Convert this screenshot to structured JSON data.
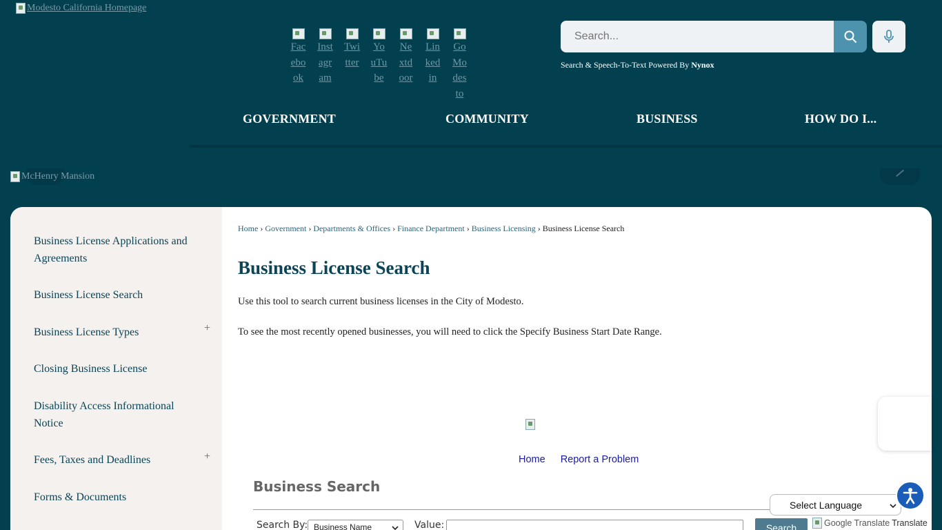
{
  "header": {
    "logo_alt": "Modesto California Homepage",
    "social": [
      {
        "label": "Facebook",
        "lines": [
          "Fac",
          "ebo",
          "ok"
        ]
      },
      {
        "label": "Instagram",
        "lines": [
          "Inst",
          "agr",
          "am"
        ]
      },
      {
        "label": "Twitter",
        "lines": [
          "Twi",
          "tter"
        ]
      },
      {
        "label": "YouTube",
        "lines": [
          "Yo",
          "uTu",
          "be"
        ]
      },
      {
        "label": "Nextdoor",
        "lines": [
          "Ne",
          "xtd",
          "oor"
        ]
      },
      {
        "label": "Linkedin",
        "lines": [
          "Lin",
          "ked",
          "in"
        ]
      },
      {
        "label": "GoModesto",
        "lines": [
          "Go",
          "Mo",
          "des",
          "to"
        ]
      }
    ],
    "search_placeholder": "Search...",
    "powered_text": "Search & Speech-To-Text Powered By",
    "powered_brand": "Nynox"
  },
  "nav": {
    "items": [
      "GOVERNMENT",
      "COMMUNITY",
      "BUSINESS",
      "HOW DO I..."
    ]
  },
  "hero": {
    "image_alt": "McHenry Mansion"
  },
  "sidebar": {
    "items": [
      {
        "label": "Business License Applications and Agreements",
        "expandable": false
      },
      {
        "label": "Business License Search",
        "expandable": false
      },
      {
        "label": "Business License Types",
        "expandable": true
      },
      {
        "label": "Closing Business License",
        "expandable": false
      },
      {
        "label": "Disability Access Informational Notice",
        "expandable": false
      },
      {
        "label": "Fees, Taxes and Deadlines",
        "expandable": true
      },
      {
        "label": "Forms & Documents",
        "expandable": false
      }
    ],
    "plus": "+"
  },
  "breadcrumb": {
    "links": [
      "Home",
      "Government",
      "Departments & Offices",
      "Finance Department",
      "Business Licensing"
    ],
    "separator": "›",
    "current": "Business License Search"
  },
  "main": {
    "title": "Business License Search",
    "para1": "Use this tool to search current business licenses in the City of Modesto.",
    "para2": "To see the most recently opened businesses, you will need to click the Specify Business Start Date Range.",
    "embed_links": [
      "Home",
      "Report a Problem"
    ],
    "business_search": {
      "title": "Business Search",
      "search_by_label": "Search By:",
      "search_by_value": "Business Name",
      "value_label": "Value:",
      "button": "Search"
    }
  },
  "widgets": {
    "language_select": "Select Language",
    "google_translate": "Google Translate",
    "translate": "Translate"
  },
  "colors": {
    "header_bg": "#02404f",
    "accent": "#4d93ad",
    "title": "#0a4456"
  }
}
